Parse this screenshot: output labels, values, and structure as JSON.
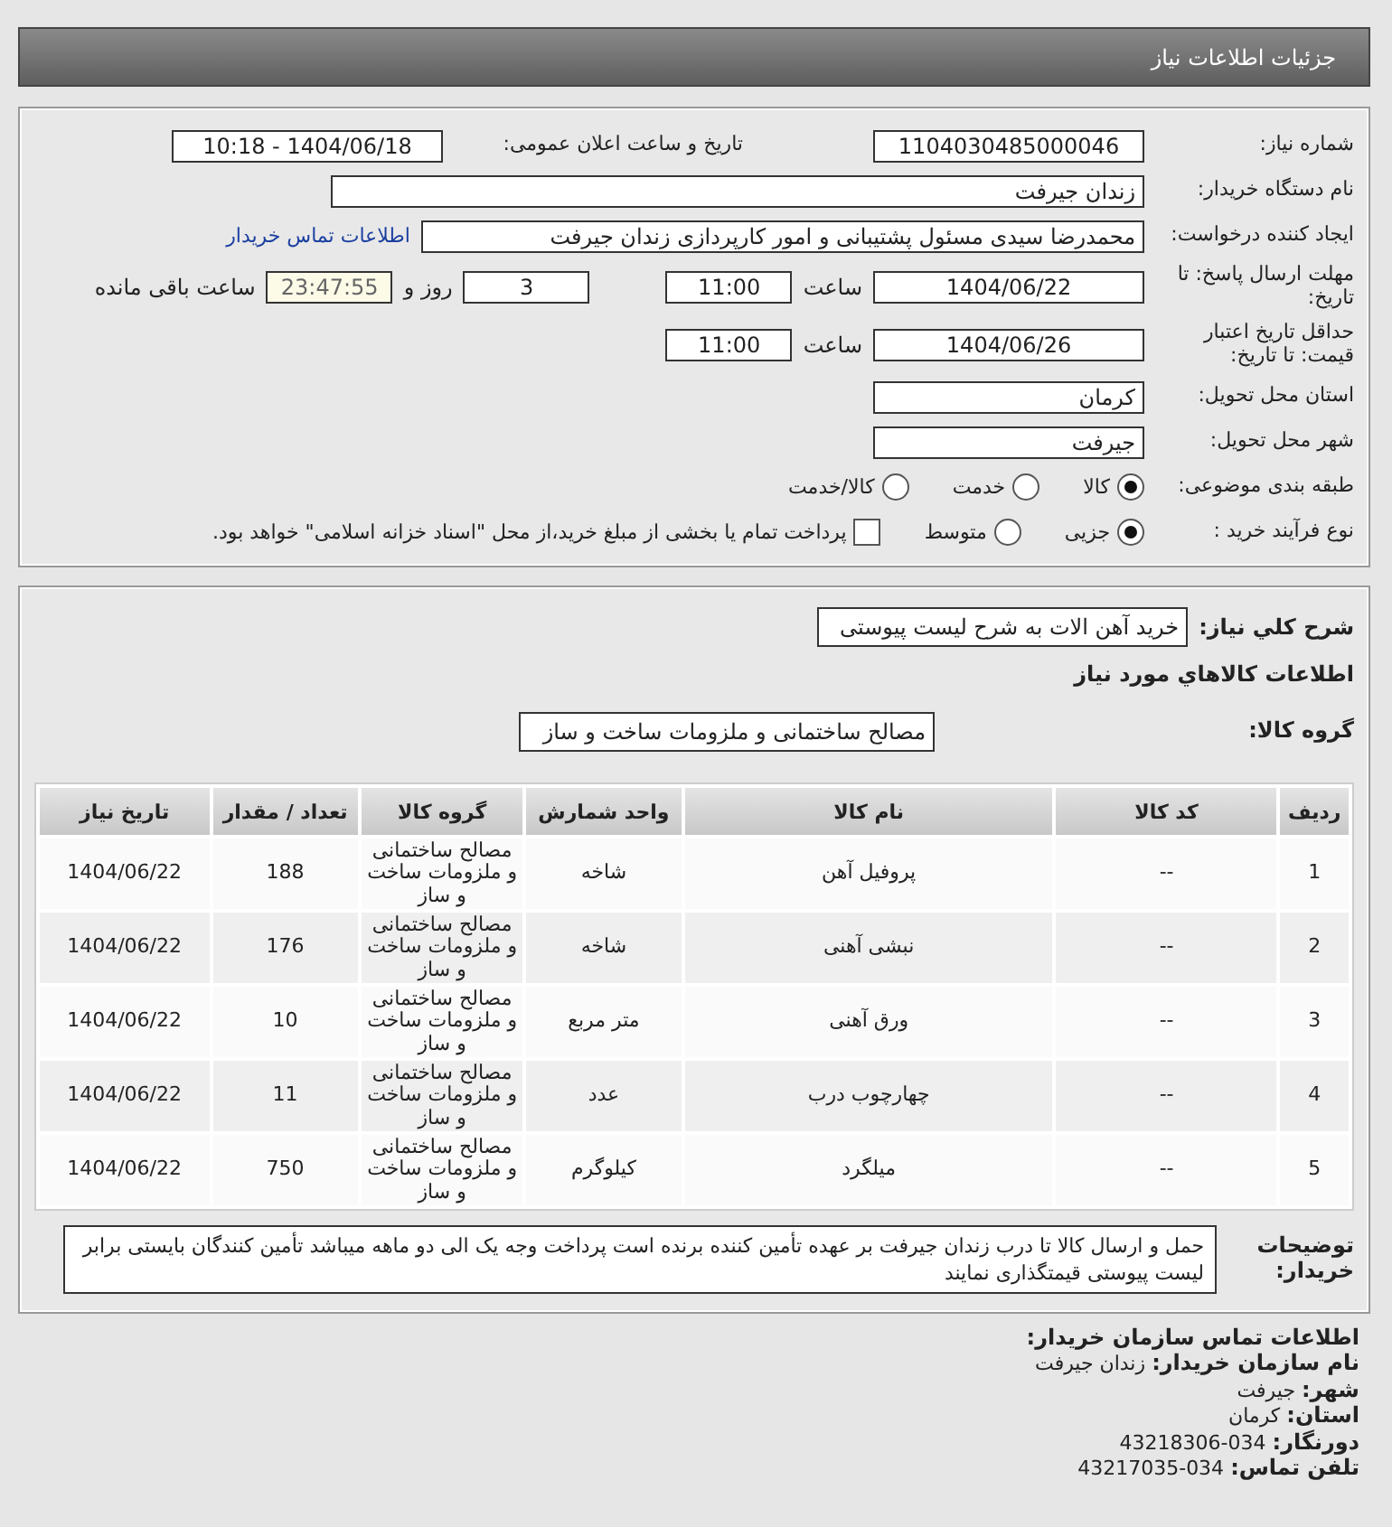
{
  "header": {
    "title": "جزئیات اطلاعات نیاز"
  },
  "need": {
    "number_label": "شماره نیاز:",
    "number": "1104030485000046",
    "announce_label": "تاریخ و ساعت اعلان عمومی:",
    "announce": "1404/06/18 - 10:18",
    "buyer_label": "نام دستگاه خریدار:",
    "buyer": "زندان جیرفت",
    "creator_label": "ایجاد کننده درخواست:",
    "creator": "محمدرضا سیدی مسئول پشتیبانی و امور کارپردازی زندان جیرفت",
    "contact_link": "اطلاعات تماس خریدار",
    "deadline_label": "مهلت ارسال پاسخ: تا تاریخ:",
    "deadline_date": "1404/06/22",
    "time_label": "ساعت",
    "deadline_time": "11:00",
    "days": "3",
    "days_label": "روز و",
    "remaining": "23:47:55",
    "remaining_label": "ساعت باقی مانده",
    "validity_label": "حداقل تاریخ اعتبار قیمت: تا تاریخ:",
    "validity_date": "1404/06/26",
    "validity_time_label": "ساعت",
    "validity_time": "11:00",
    "province_label": "استان محل تحویل:",
    "province": "کرمان",
    "city_label": "شهر محل تحویل:",
    "city": "جیرفت",
    "category_label": "طبقه بندی موضوعی:",
    "categories": [
      {
        "label": "کالا",
        "selected": true
      },
      {
        "label": "خدمت",
        "selected": false
      },
      {
        "label": "کالا/خدمت",
        "selected": false
      }
    ],
    "process_label": "نوع فرآیند خرید :",
    "processes": [
      {
        "label": "جزیی",
        "selected": true
      },
      {
        "label": "متوسط",
        "selected": false
      }
    ],
    "treasury": {
      "label": "پرداخت تمام یا بخشی از مبلغ خرید،از محل \"اسناد خزانه اسلامی\" خواهد بود.",
      "checked": false
    }
  },
  "summary": {
    "label": "شرح کلي نياز:",
    "value": "خرید آهن الات به شرح لیست پیوستی",
    "goods_title": "اطلاعات کالاهاي مورد نياز",
    "group_label": "گروه کالا:",
    "group": "مصالح ساختمانی و ملزومات ساخت و ساز"
  },
  "table": {
    "columns": [
      "ردیف",
      "کد کالا",
      "نام کالا",
      "واحد شمارش",
      "گروه کالا",
      "تعداد / مقدار",
      "تاریخ نیاز"
    ],
    "rows": [
      [
        "1",
        "--",
        "پروفیل آهن",
        "شاخه",
        "مصالح ساختمانی و ملزومات ساخت و ساز",
        "188",
        "1404/06/22"
      ],
      [
        "2",
        "--",
        "نبشی آهنی",
        "شاخه",
        "مصالح ساختمانی و ملزومات ساخت و ساز",
        "176",
        "1404/06/22"
      ],
      [
        "3",
        "--",
        "ورق آهنی",
        "متر مربع",
        "مصالح ساختمانی و ملزومات ساخت و ساز",
        "10",
        "1404/06/22"
      ],
      [
        "4",
        "--",
        "چهارچوب درب",
        "عدد",
        "مصالح ساختمانی و ملزومات ساخت و ساز",
        "11",
        "1404/06/22"
      ],
      [
        "5",
        "--",
        "میلگرد",
        "کیلوگرم",
        "مصالح ساختمانی و ملزومات ساخت و ساز",
        "750",
        "1404/06/22"
      ]
    ]
  },
  "notes": {
    "label": "توضیحات خریدار:",
    "text": "حمل و ارسال کالا تا درب زندان جیرفت بر عهده تأمین کننده برنده است پرداخت وجه یک الی دو ماهه میباشد تأمین کنندگان بایستی برابر لیست پیوستی قیمتگذاری نمایند"
  },
  "contact": {
    "title": "اطلاعات تماس سازمان خریدار:",
    "lines": [
      {
        "label": "نام سازمان خریدار:",
        "value": "زندان جیرفت"
      },
      {
        "label": "شهر:",
        "value": "جیرفت"
      },
      {
        "label": "استان:",
        "value": "کرمان"
      },
      {
        "label": "دورنگار:",
        "value": "034-43218306"
      },
      {
        "label": "تلفن تماس:",
        "value": "034-43217035"
      }
    ]
  }
}
